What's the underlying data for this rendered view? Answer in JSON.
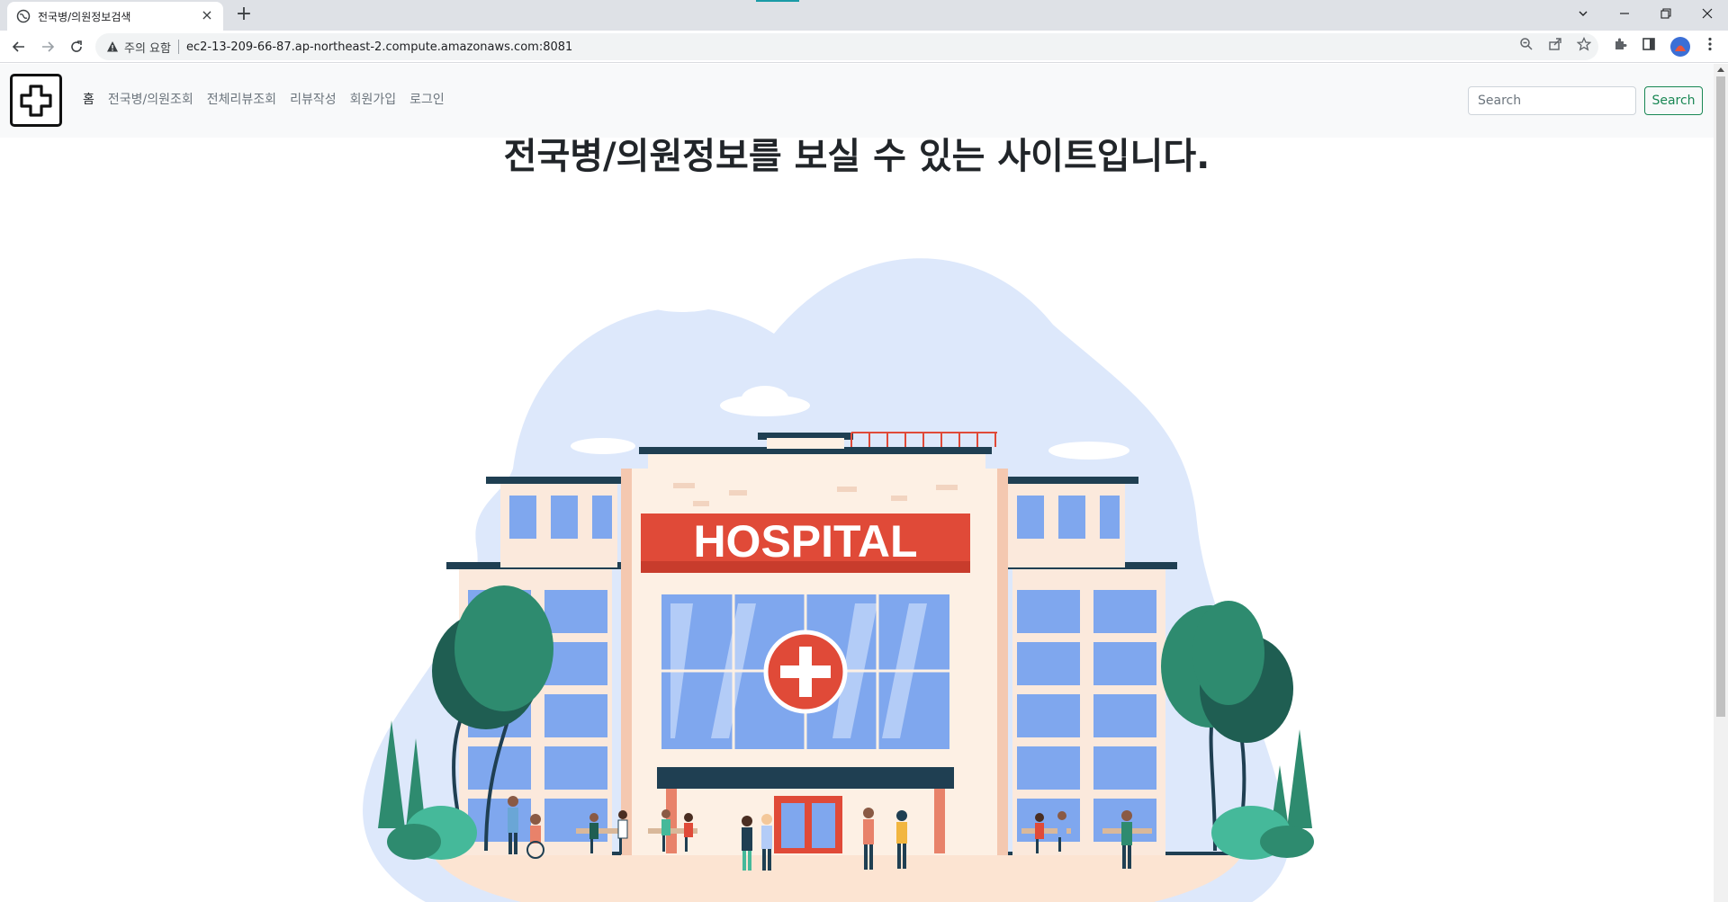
{
  "browser": {
    "tab_title": "전국병/의원정보검색",
    "tab_close": "×",
    "new_tab": "+",
    "security_label": "주의 요함",
    "url": "ec2-13-209-66-87.ap-northeast-2.compute.amazonaws.com:8081",
    "icons": [
      "back-icon",
      "forward-icon",
      "reload-icon",
      "warning-icon",
      "zoom-icon",
      "share-icon",
      "star-icon",
      "extensions-icon",
      "sidepanel-icon",
      "profile-icon",
      "menu-icon"
    ]
  },
  "navbar": {
    "links": [
      {
        "label": "홈",
        "active": true
      },
      {
        "label": "전국병/의원조회",
        "active": false
      },
      {
        "label": "전체리뷰조회",
        "active": false
      },
      {
        "label": "리뷰작성",
        "active": false
      },
      {
        "label": "회원가입",
        "active": false
      },
      {
        "label": "로그인",
        "active": false
      }
    ],
    "search_placeholder": "Search",
    "search_button": "Search"
  },
  "main": {
    "headline": "전국병/의원정보를 보실 수 있는 사이트입니다.",
    "illustration_sign": "HOSPITAL"
  },
  "colors": {
    "navbar_bg": "#f8f9fa",
    "search_green": "#198754",
    "hospital_red": "#e04a38",
    "tree_green": "#2e8b6f",
    "blob_blue": "#dde8fb",
    "window_blue": "#7fa7ee",
    "dark_teal": "#1f3f52"
  }
}
